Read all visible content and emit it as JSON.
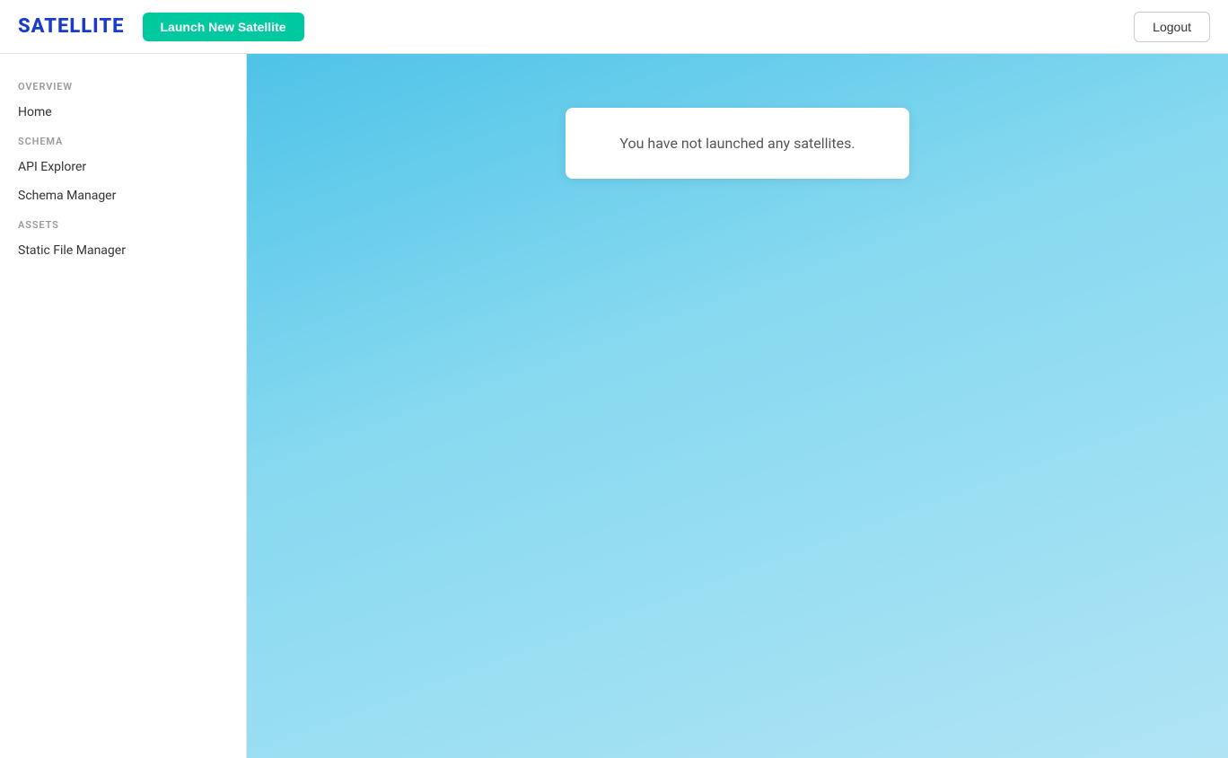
{
  "header": {
    "logo": "SATELLITE",
    "launch_button_label": "Launch New Satellite",
    "logout_button_label": "Logout"
  },
  "sidebar": {
    "sections": [
      {
        "label": "OVERVIEW",
        "items": [
          {
            "id": "home",
            "label": "Home"
          }
        ]
      },
      {
        "label": "SCHEMA",
        "items": [
          {
            "id": "api-explorer",
            "label": "API Explorer"
          },
          {
            "id": "schema-manager",
            "label": "Schema Manager"
          }
        ]
      },
      {
        "label": "ASSETS",
        "items": [
          {
            "id": "static-file-manager",
            "label": "Static File Manager"
          }
        ]
      }
    ]
  },
  "main": {
    "empty_message": "You have not launched any satellites."
  }
}
